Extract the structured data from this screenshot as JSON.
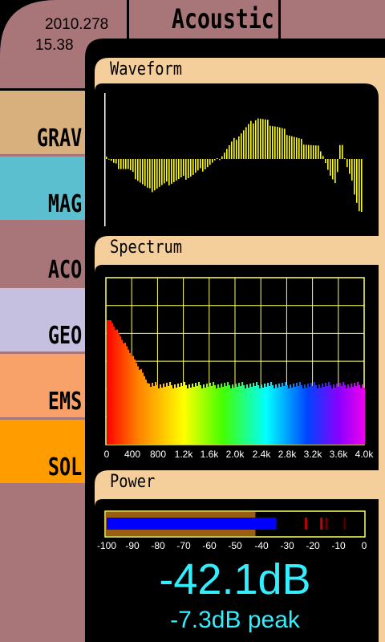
{
  "header": {
    "date": "2010.278",
    "time": "15.38",
    "title": "Acoustic"
  },
  "nav": [
    {
      "label": "GRAV",
      "color": "#d8b07d"
    },
    {
      "label": "MAG",
      "color": "#5bbfd0"
    },
    {
      "label": "ACO",
      "color": "#a87679"
    },
    {
      "label": "GEO",
      "color": "#c5bfe0"
    },
    {
      "label": "EMS",
      "color": "#f8a26a"
    },
    {
      "label": "SOL",
      "color": "#ff9c00"
    }
  ],
  "sections": {
    "waveform": "Waveform",
    "spectrum": "Spectrum",
    "power": "Power"
  },
  "spectrum_axis": [
    "0",
    "400",
    "800",
    "1.2k",
    "1.6k",
    "2.0k",
    "2.4k",
    "2.8k",
    "3.2k",
    "3.6k",
    "4.0k"
  ],
  "power_axis": [
    "-100",
    "-90",
    "-80",
    "-70",
    "-60",
    "-50",
    "-40",
    "-30",
    "-20",
    "-10",
    "0"
  ],
  "readout": {
    "level": "-42.1dB",
    "peak": "-7.3dB peak"
  },
  "power_meter": {
    "average_db": -42.1,
    "current_db": -34,
    "peak_db": -7.3,
    "range_db": [
      -100,
      0
    ]
  },
  "colors": {
    "frame": "#a87679",
    "panel": "#f5cf9b",
    "grid": "#ffff66",
    "wave": "#ffff00",
    "readout": "#33eeff",
    "meter_bar": "#0000ff",
    "meter_bg": "#9a5e12",
    "meter_peak": "#cc0000"
  }
}
